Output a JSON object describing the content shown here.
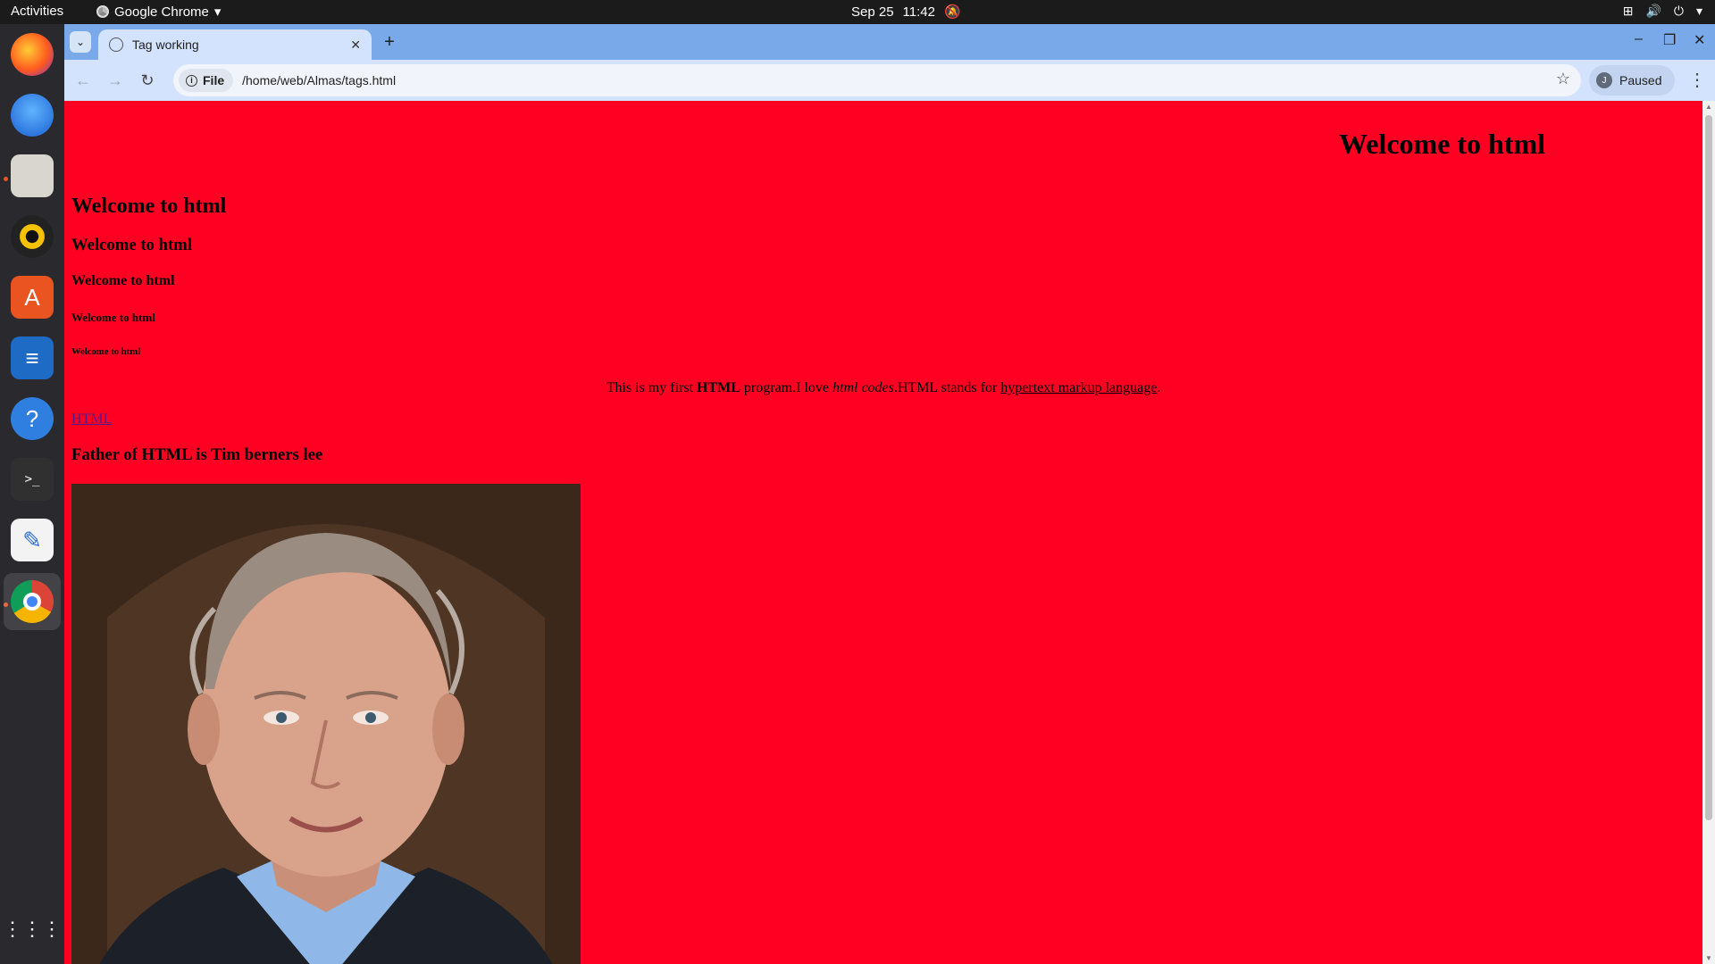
{
  "topbar": {
    "activities": "Activities",
    "app_name": "Google Chrome",
    "date": "Sep 25",
    "time": "11:42"
  },
  "dock": {
    "items": [
      "firefox-icon",
      "thunderbird-icon",
      "files-icon",
      "rhythmbox-icon",
      "app-center-icon",
      "writer-icon",
      "help-icon",
      "terminal-icon",
      "text-editor-icon",
      "chrome-icon",
      "app-grid-icon"
    ]
  },
  "browser": {
    "tab_title": "Tag working",
    "chip_label": "File",
    "url": "/home/web/Almas/tags.html",
    "profile_initial": "J",
    "profile_status": "Paused"
  },
  "page": {
    "background": "#ff0022",
    "heading_right": "Welcome to html",
    "h1": "Welcome to html",
    "h3": "Welcome to html",
    "h4": "Welcome to html",
    "h5": "Welcome to html",
    "h6": "Welcome to html",
    "para_1": "This is my first ",
    "para_bold": "HTML",
    "para_2": " program.I love ",
    "para_italic": "html codes",
    "para_3": ".HTML stands for ",
    "para_link": "hypertext markup language",
    "para_4": ".",
    "link_text": "HTML",
    "father": "Father of HTML is Tim berners lee"
  }
}
